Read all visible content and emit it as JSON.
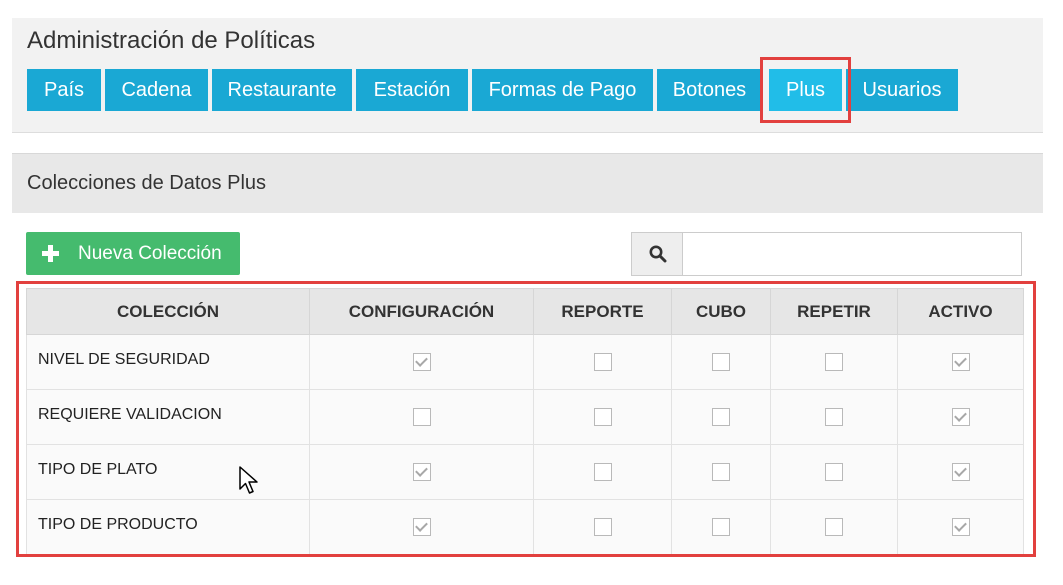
{
  "page": {
    "title": "Administración de Políticas"
  },
  "tabs": [
    {
      "label": "País",
      "active": false
    },
    {
      "label": "Cadena",
      "active": false
    },
    {
      "label": "Restaurante",
      "active": false
    },
    {
      "label": "Estación",
      "active": false
    },
    {
      "label": "Formas de Pago",
      "active": false
    },
    {
      "label": "Botones",
      "active": false
    },
    {
      "label": "Plus",
      "active": true
    },
    {
      "label": "Usuarios",
      "active": false
    }
  ],
  "section": {
    "title": "Colecciones de Datos Plus"
  },
  "toolbar": {
    "new_label": "Nueva Colección",
    "search_value": "",
    "search_icon": "search-icon"
  },
  "table": {
    "headers": [
      "COLECCIÓN",
      "CONFIGURACIÓN",
      "REPORTE",
      "CUBO",
      "REPETIR",
      "ACTIVO"
    ],
    "rows": [
      {
        "name": "NIVEL DE SEGURIDAD",
        "configuracion": true,
        "reporte": false,
        "cubo": false,
        "repetir": false,
        "activo": true
      },
      {
        "name": "REQUIERE VALIDACION",
        "configuracion": false,
        "reporte": false,
        "cubo": false,
        "repetir": false,
        "activo": true
      },
      {
        "name": "TIPO DE PLATO",
        "configuracion": true,
        "reporte": false,
        "cubo": false,
        "repetir": false,
        "activo": true
      },
      {
        "name": "TIPO DE PRODUCTO",
        "configuracion": true,
        "reporte": false,
        "cubo": false,
        "repetir": false,
        "activo": true
      }
    ]
  },
  "colors": {
    "tab": "#1aa8d4",
    "tab_active": "#21bde8",
    "new_button": "#45bb6e",
    "highlight": "#e2403e"
  }
}
